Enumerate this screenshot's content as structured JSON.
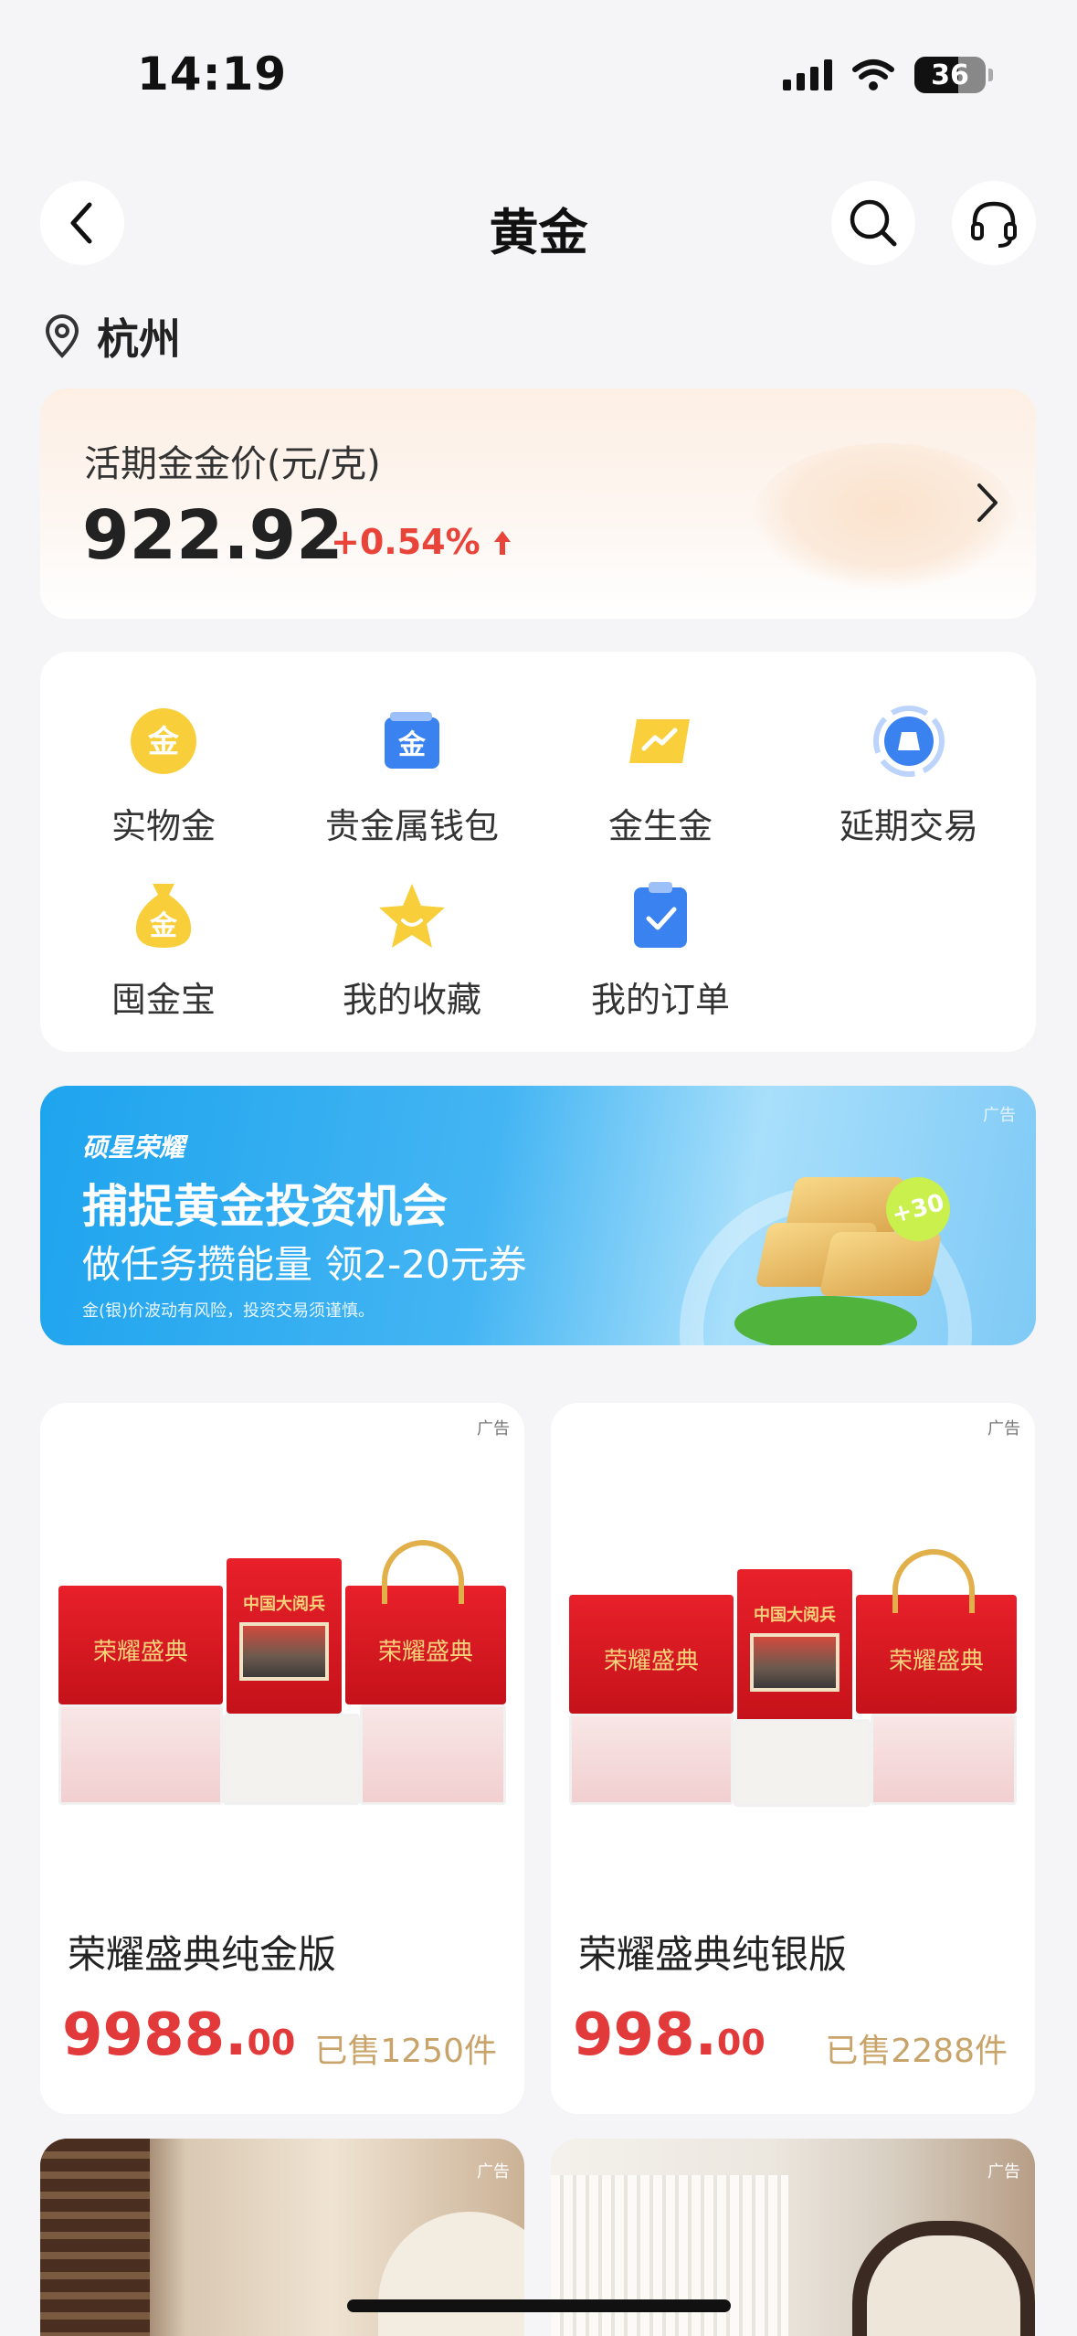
{
  "status_bar": {
    "time": "14:19",
    "battery": "36"
  },
  "nav": {
    "title": "黄金"
  },
  "location": {
    "city": "杭州"
  },
  "price_card": {
    "label": "活期金金价(元/克)",
    "price": "922.92",
    "change": "+0.54%"
  },
  "functions": [
    {
      "label": "实物金",
      "icon": "gold-coin-icon",
      "glyph": "金"
    },
    {
      "label": "贵金属钱包",
      "icon": "wallet-icon",
      "glyph": "金"
    },
    {
      "label": "金生金",
      "icon": "trend-icon",
      "glyph": ""
    },
    {
      "label": "延期交易",
      "icon": "deferred-trade-icon",
      "glyph": ""
    },
    {
      "label": "囤金宝",
      "icon": "money-bag-icon",
      "glyph": "金"
    },
    {
      "label": "我的收藏",
      "icon": "star-icon",
      "glyph": ""
    },
    {
      "label": "我的订单",
      "icon": "order-icon",
      "glyph": ""
    }
  ],
  "banner": {
    "brand": "硕星荣耀",
    "title": "捕捉黄金投资机会",
    "subtitle": "做任务攒能量 领2-20元券",
    "disclaimer": "金(银)价波动有风险，投资交易须谨慎。",
    "ad": "广告",
    "coin": "+30"
  },
  "products": [
    {
      "name": "荣耀盛典纯金版",
      "price_int": "9988.",
      "price_dec": "00",
      "sold": "已售1250件",
      "ad": "广告",
      "box_title": "中国大阅兵",
      "box_text": "荣耀盛典"
    },
    {
      "name": "荣耀盛典纯银版",
      "price_int": "998.",
      "price_dec": "00",
      "sold": "已售2288件",
      "ad": "广告",
      "box_title": "中国大阅兵",
      "box_text": "荣耀盛典"
    }
  ],
  "rooms": [
    {
      "ad": "广告"
    },
    {
      "ad": "广告"
    }
  ],
  "colors": {
    "accent_red": "#e23a3a",
    "gold": "#c9a46a",
    "banner_blue": "#1ea4ee"
  }
}
